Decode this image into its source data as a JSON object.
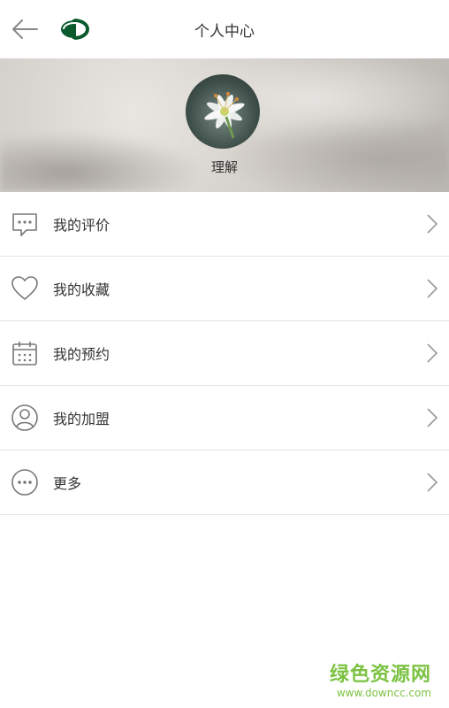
{
  "header": {
    "title": "个人中心",
    "back_icon": "arrow-left-icon",
    "logo": "brand-logo"
  },
  "profile": {
    "username": "理解",
    "avatar": "flower-avatar"
  },
  "menu": {
    "items": [
      {
        "label": "我的评价",
        "icon": "comment-icon"
      },
      {
        "label": "我的收藏",
        "icon": "heart-icon"
      },
      {
        "label": "我的预约",
        "icon": "calendar-icon"
      },
      {
        "label": "我的加盟",
        "icon": "user-icon"
      },
      {
        "label": "更多",
        "icon": "more-icon"
      }
    ]
  },
  "watermark": {
    "cn": "绿色资源网",
    "en": "www.downcc.com"
  },
  "colors": {
    "brand": "#0a5a2e",
    "watermark": "#7cc242",
    "divider": "#e2e2e2"
  }
}
